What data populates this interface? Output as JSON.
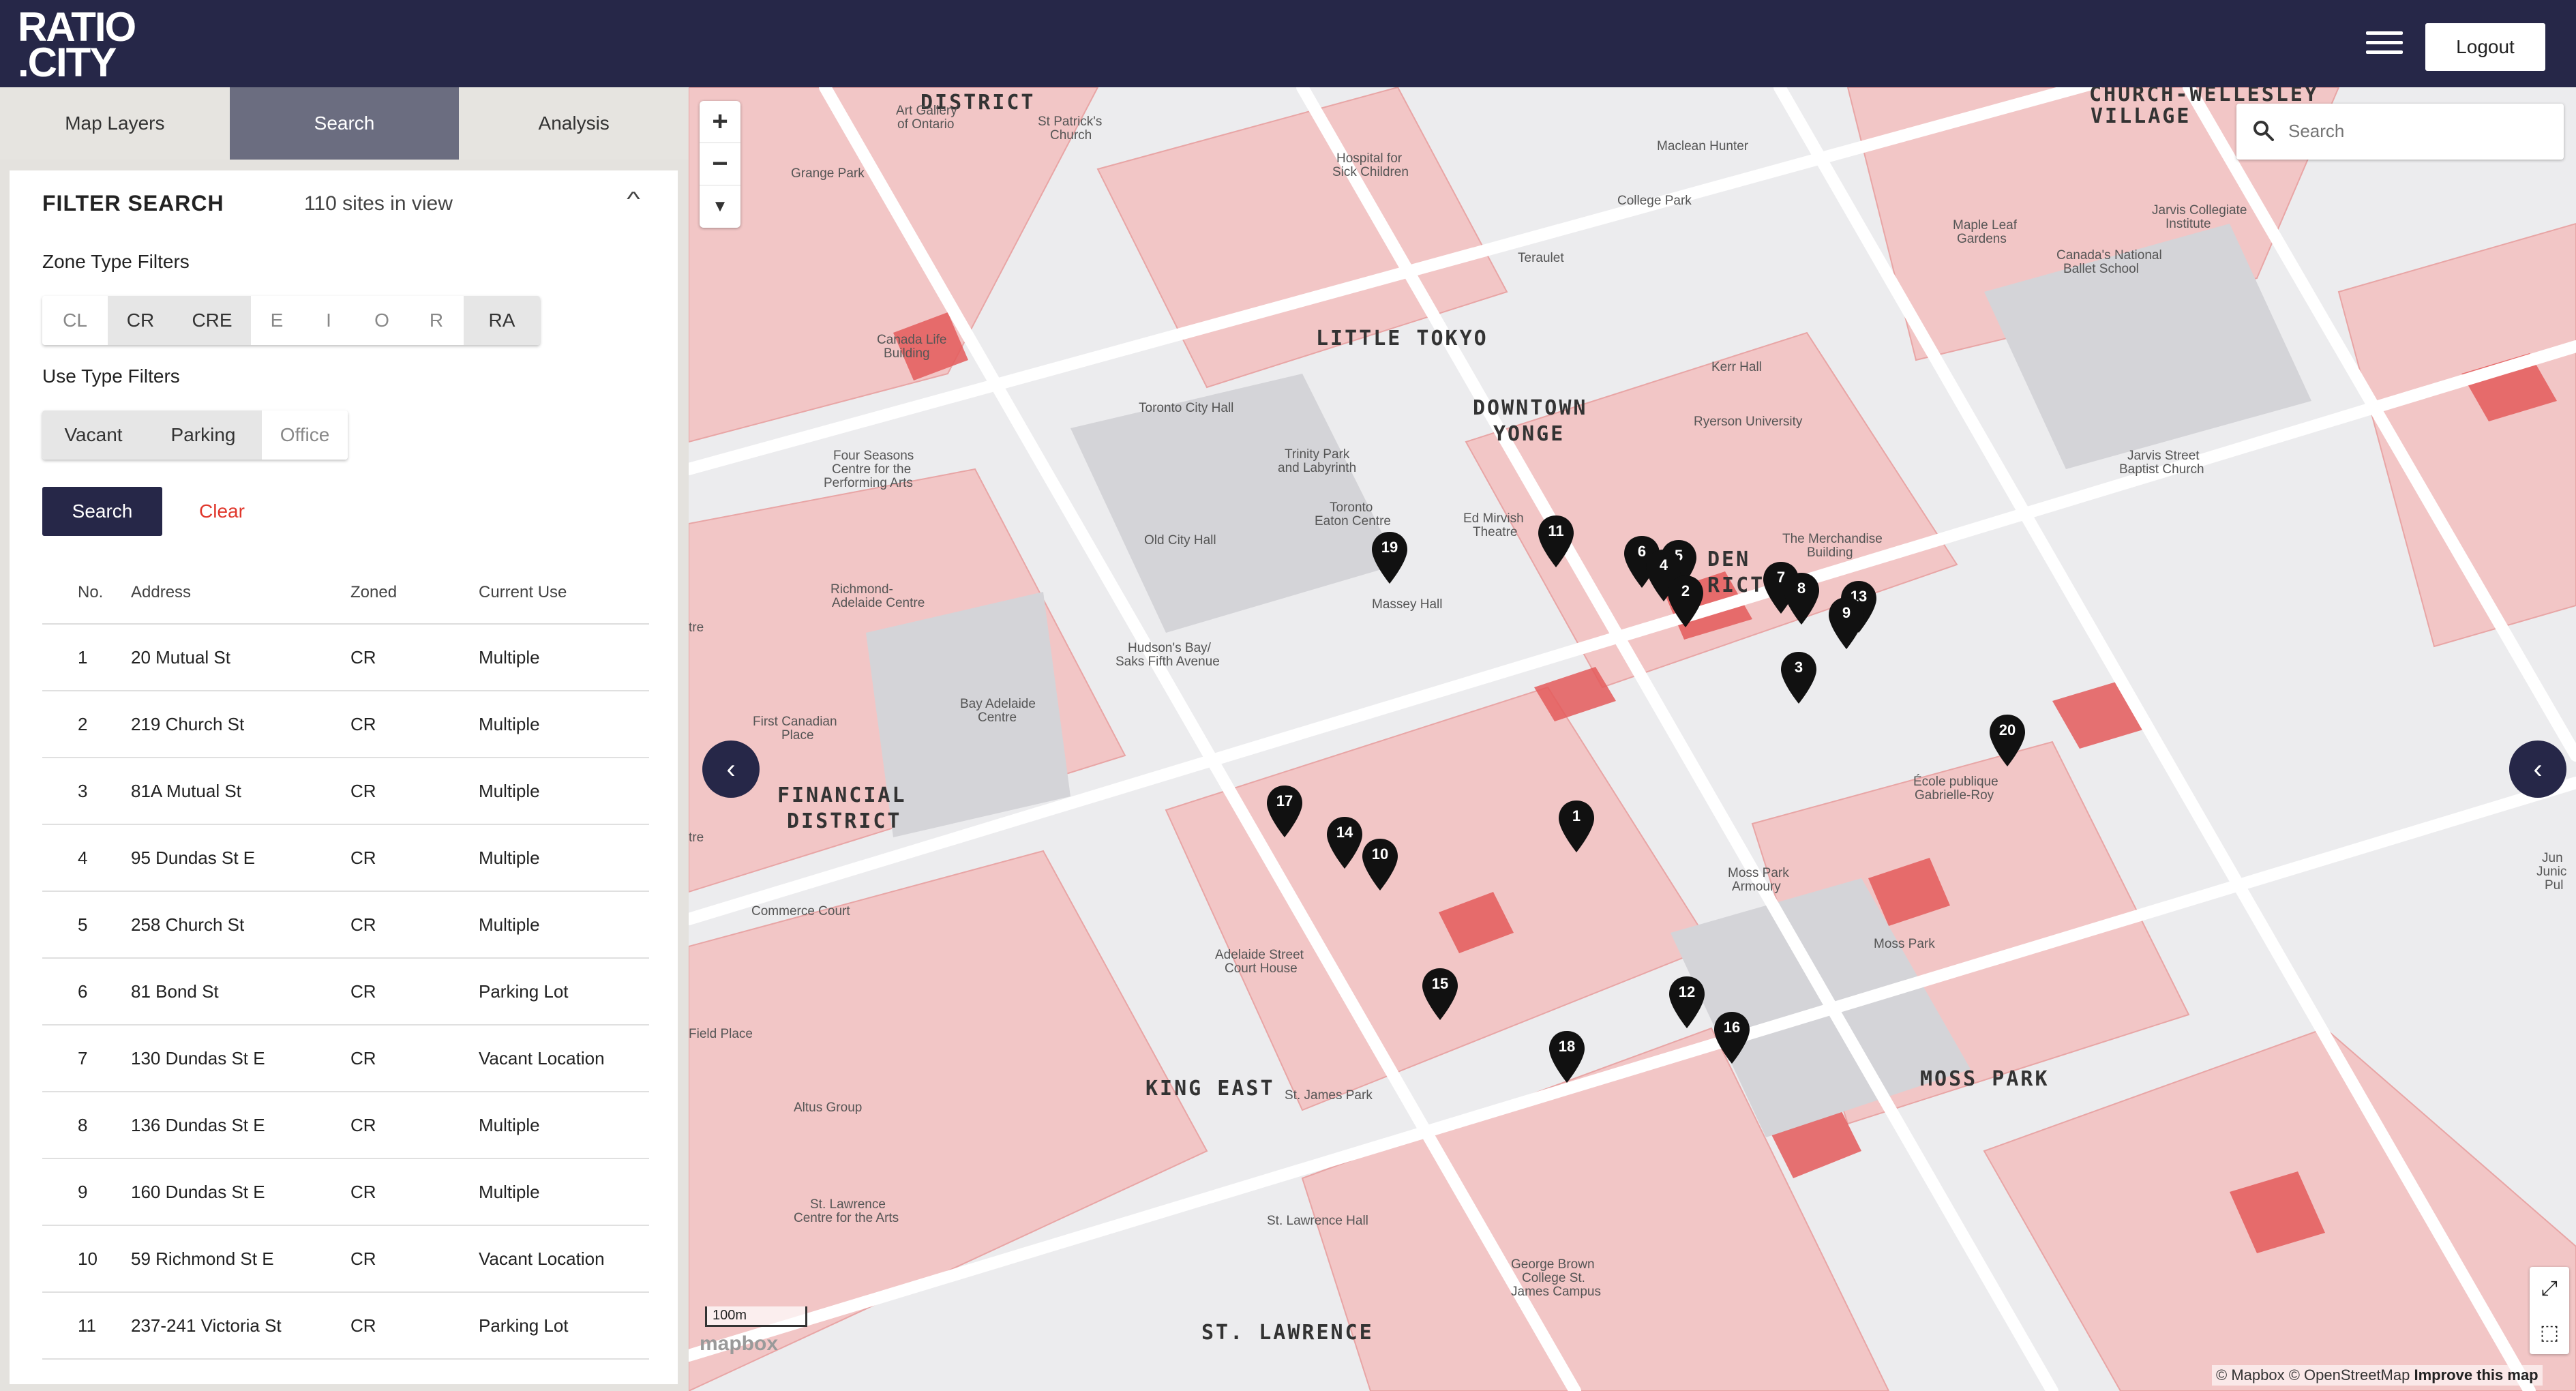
{
  "app": {
    "logo_line1": "RATIO",
    "logo_line2": ".CITY",
    "logout_label": "Logout"
  },
  "tabs": [
    {
      "label": "Map Layers",
      "active": false
    },
    {
      "label": "Search",
      "active": true
    },
    {
      "label": "Analysis",
      "active": false
    }
  ],
  "filter": {
    "title": "FILTER SEARCH",
    "sites_count": "110 sites in view",
    "zone_label": "Zone Type Filters",
    "zone_types": [
      {
        "label": "CL",
        "selected": false
      },
      {
        "label": "CR",
        "selected": true
      },
      {
        "label": "CRE",
        "selected": true
      },
      {
        "label": "E",
        "selected": false
      },
      {
        "label": "I",
        "selected": false
      },
      {
        "label": "O",
        "selected": false
      },
      {
        "label": "R",
        "selected": false
      },
      {
        "label": "RA",
        "selected": true
      }
    ],
    "use_label": "Use Type Filters",
    "use_types": [
      {
        "label": "Vacant",
        "selected": true
      },
      {
        "label": "Parking",
        "selected": true
      },
      {
        "label": "Office",
        "selected": false
      }
    ],
    "search_label": "Search",
    "clear_label": "Clear"
  },
  "table": {
    "headers": [
      "No.",
      "Address",
      "Zoned",
      "Current Use"
    ],
    "rows": [
      {
        "no": "1",
        "address": "20 Mutual St",
        "zoned": "CR",
        "use": "Multiple"
      },
      {
        "no": "2",
        "address": "219 Church St",
        "zoned": "CR",
        "use": "Multiple"
      },
      {
        "no": "3",
        "address": "81A Mutual St",
        "zoned": "CR",
        "use": "Multiple"
      },
      {
        "no": "4",
        "address": "95 Dundas St E",
        "zoned": "CR",
        "use": "Multiple"
      },
      {
        "no": "5",
        "address": "258 Church St",
        "zoned": "CR",
        "use": "Multiple"
      },
      {
        "no": "6",
        "address": "81 Bond St",
        "zoned": "CR",
        "use": "Parking Lot"
      },
      {
        "no": "7",
        "address": "130 Dundas St E",
        "zoned": "CR",
        "use": "Vacant Location"
      },
      {
        "no": "8",
        "address": "136 Dundas St E",
        "zoned": "CR",
        "use": "Multiple"
      },
      {
        "no": "9",
        "address": "160 Dundas St E",
        "zoned": "CR",
        "use": "Multiple"
      },
      {
        "no": "10",
        "address": "59 Richmond St E",
        "zoned": "CR",
        "use": "Vacant Location"
      },
      {
        "no": "11",
        "address": "237-241 Victoria St",
        "zoned": "CR",
        "use": "Parking Lot"
      }
    ]
  },
  "map": {
    "search_placeholder": "Search",
    "scale_label": "100m",
    "mapbox_logo": "mapbox",
    "attribution_prefix": "© Mapbox © OpenStreetMap",
    "attribution_link": "Improve this map",
    "districts": [
      "DISTRICT",
      "LITTLE TOKYO",
      "DOWNTOWN",
      "YONGE",
      "FINANCIAL",
      "DISTRICT",
      "KING EAST",
      "ST. LAWRENCE",
      "MOSS PARK",
      "CHURCH-WELLESLEY",
      "VILLAGE",
      "DEN",
      "RICT"
    ],
    "labels": [
      "Art Gallery",
      "of Ontario",
      "St Patrick's",
      "Church",
      "Grange Park",
      "Hospital for",
      "Sick Children",
      "Maclean Hunter",
      "College Park",
      "Maple Leaf",
      "Gardens",
      "Jarvis Collegiate",
      "Institute",
      "Canada's National",
      "Ballet School",
      "Teraulet",
      "Canada Life",
      "Building",
      "Kerr Hall",
      "Ryerson University",
      "Toronto City Hall",
      "Four Seasons",
      "Centre for the",
      "Performing Arts",
      "Trinity Park",
      "and Labyrinth",
      "Toronto",
      "Eaton Centre",
      "Ed Mirvish",
      "Theatre",
      "Old City Hall",
      "Massey Hall",
      "The Merchandise",
      "Building",
      "Jarvis Street",
      "Baptist Church",
      "Richmond-",
      "Adelaide Centre",
      "Hudson's Bay/",
      "Saks Fifth Avenue",
      "First Canadian",
      "Place",
      "Bay Adelaide",
      "Centre",
      "École publique",
      "Gabrielle-Roy",
      "Moss Park",
      "Armoury",
      "Moss Park",
      "Commerce Court",
      "Adelaide Street",
      "Court House",
      "Field Place",
      "St. James Park",
      "Altus Group",
      "St. Lawrence",
      "Centre for the Arts",
      "St. Lawrence Hall",
      "George Brown",
      "College St.",
      "James Campus",
      "tre",
      "tre",
      "Jun",
      "Junic",
      "Pul"
    ],
    "markers": [
      "19",
      "11",
      "6",
      "5",
      "4",
      "2",
      "7",
      "8",
      "13",
      "9",
      "3",
      "20",
      "1",
      "17",
      "14",
      "10",
      "15",
      "12",
      "16",
      "18"
    ],
    "colors": {
      "navy": "#262748",
      "zone_red": "#e45b5b",
      "zone_pink": "#f2c4c4"
    }
  }
}
